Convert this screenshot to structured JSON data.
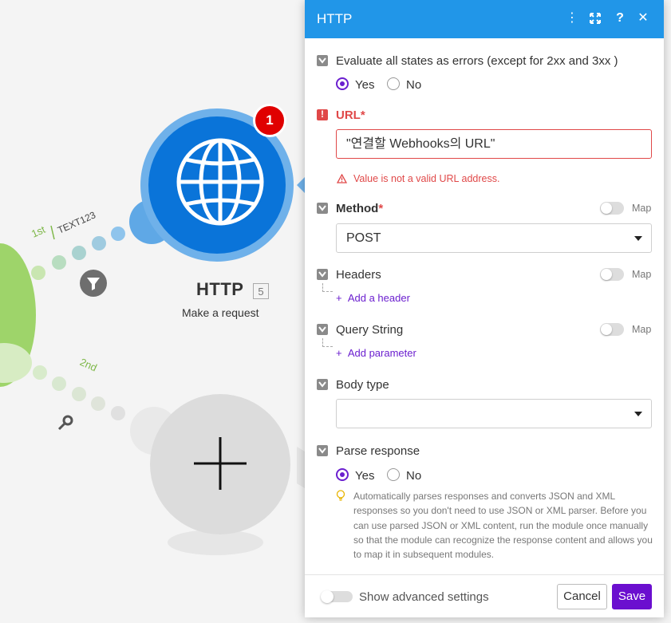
{
  "canvas": {
    "module": {
      "name": "HTTP",
      "id": "5",
      "subtitle": "Make a request",
      "badge": "1"
    },
    "routes": {
      "first_label": "1st",
      "first_filter": "TEXT123",
      "second_label": "2nd"
    }
  },
  "panel": {
    "title": "HTTP",
    "header_icons": [
      "more-icon",
      "expand-icon",
      "help-icon",
      "close-icon"
    ],
    "evaluate": {
      "label": "Evaluate all states as errors (except for 2xx and 3xx )",
      "options": [
        "Yes",
        "No"
      ],
      "selected": "Yes"
    },
    "url": {
      "label": "URL",
      "required_mark": "*",
      "value": "\"연결할 Webhooks의 URL\"",
      "error": "Value is not a valid URL address."
    },
    "method": {
      "label": "Method",
      "required_mark": "*",
      "value": "POST",
      "map_label": "Map"
    },
    "headers": {
      "label": "Headers",
      "map_label": "Map",
      "add_label": "Add a header"
    },
    "query_string": {
      "label": "Query String",
      "map_label": "Map",
      "add_label": "Add parameter"
    },
    "body_type": {
      "label": "Body type",
      "value": ""
    },
    "parse_response": {
      "label": "Parse response",
      "options": [
        "Yes",
        "No"
      ],
      "selected": "Yes",
      "hint": "Automatically parses responses and converts JSON and XML responses so you don't need to use JSON or XML parser. Before you can use parsed JSON or XML content, run the module once manually so that the module can recognize the response content and allows you to map it in subsequent modules."
    },
    "footer": {
      "advanced_label": "Show advanced settings",
      "cancel_label": "Cancel",
      "save_label": "Save"
    }
  },
  "colors": {
    "header_blue": "#2196e8",
    "primary_purple": "#6b0fcf",
    "error_red": "#e04848",
    "route_green": "#7fb84a"
  }
}
